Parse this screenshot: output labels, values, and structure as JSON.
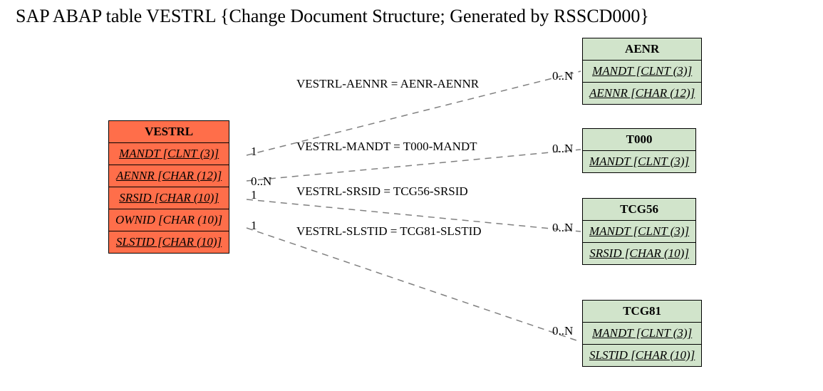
{
  "title": "SAP ABAP table VESTRL {Change Document Structure; Generated by RSSCD000}",
  "main": {
    "name": "VESTRL",
    "fields": [
      "MANDT [CLNT (3)]",
      "AENNR [CHAR (12)]",
      "SRSID [CHAR (10)]",
      "OWNID [CHAR (10)]",
      "SLSTID [CHAR (10)]"
    ]
  },
  "refs": {
    "aenr": {
      "name": "AENR",
      "fields": [
        "MANDT [CLNT (3)]",
        "AENNR [CHAR (12)]"
      ]
    },
    "t000": {
      "name": "T000",
      "fields": [
        "MANDT [CLNT (3)]"
      ]
    },
    "tcg56": {
      "name": "TCG56",
      "fields": [
        "MANDT [CLNT (3)]",
        "SRSID [CHAR (10)]"
      ]
    },
    "tcg81": {
      "name": "TCG81",
      "fields": [
        "MANDT [CLNT (3)]",
        "SLSTID [CHAR (10)]"
      ]
    }
  },
  "rels": {
    "r1": {
      "label": "VESTRL-AENNR = AENR-AENNR",
      "left": "1",
      "right": "0..N"
    },
    "r2": {
      "label": "VESTRL-MANDT = T000-MANDT",
      "left": "0..N",
      "right": "0..N"
    },
    "r3": {
      "label": "VESTRL-SRSID = TCG56-SRSID",
      "left": "1",
      "right": "0..N"
    },
    "r4": {
      "label": "VESTRL-SLSTID = TCG81-SLSTID",
      "left": "1",
      "right": "0..N"
    }
  }
}
